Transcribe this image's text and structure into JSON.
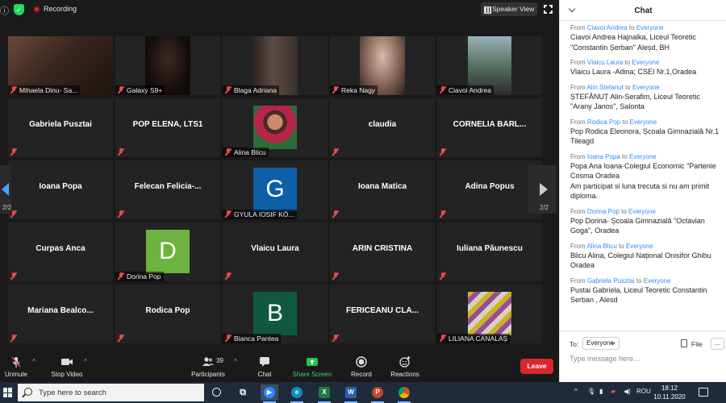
{
  "meeting": {
    "recording_label": "Recording",
    "view_button": "Speaker View",
    "page_indicator": "2/2",
    "tiles": [
      {
        "name": "",
        "label": "Mihaela Dinu- Sa...",
        "kind": "video"
      },
      {
        "name": "",
        "label": "Galaxy S9+",
        "kind": "video"
      },
      {
        "name": "",
        "label": "Blaga Adriana",
        "kind": "video"
      },
      {
        "name": "",
        "label": "Reka Nagy",
        "kind": "video"
      },
      {
        "name": "",
        "label": "Ciavoi Andrea",
        "kind": "video"
      },
      {
        "name": "Gabriela Pusztai",
        "label": "",
        "kind": "name"
      },
      {
        "name": "POP ELENA, LTS1",
        "label": "",
        "kind": "name"
      },
      {
        "name": "",
        "label": "Alina Blicu",
        "kind": "photo"
      },
      {
        "name": "claudia",
        "label": "",
        "kind": "name"
      },
      {
        "name": "CORNELIA BÂRL...",
        "label": "",
        "kind": "name"
      },
      {
        "name": "Ioana Popa",
        "label": "",
        "kind": "name"
      },
      {
        "name": "Felecan  Felicia-...",
        "label": "",
        "kind": "name"
      },
      {
        "name": "",
        "label": "GYULA IOSIF KÖ...",
        "kind": "letter",
        "letter": "G",
        "color": "#0e5fa8"
      },
      {
        "name": "Ioana Matica",
        "label": "",
        "kind": "name"
      },
      {
        "name": "Adina Popus",
        "label": "",
        "kind": "name"
      },
      {
        "name": "Curpas Anca",
        "label": "",
        "kind": "name"
      },
      {
        "name": "",
        "label": "Dorina Pop",
        "kind": "letter",
        "letter": "D",
        "color": "#6eb33f"
      },
      {
        "name": "Vlaicu Laura",
        "label": "",
        "kind": "name"
      },
      {
        "name": "ARIN CRISTINA",
        "label": "",
        "kind": "name"
      },
      {
        "name": "Iuliana Păunescu",
        "label": "",
        "kind": "name"
      },
      {
        "name": "Mariana  Bealco...",
        "label": "",
        "kind": "name"
      },
      {
        "name": "Rodica Pop",
        "label": "",
        "kind": "name"
      },
      {
        "name": "",
        "label": "Bianca Pantea",
        "kind": "letter",
        "letter": "B",
        "color": "#0f5a3e"
      },
      {
        "name": "FERICEANU  CLA...",
        "label": "",
        "kind": "name"
      },
      {
        "name": "",
        "label": "LILIANA CANALAȘ",
        "kind": "pattern"
      }
    ]
  },
  "toolbar": {
    "unmute": "Unmute",
    "stop_video": "Stop Video",
    "participants": "Participants",
    "participants_count": "39",
    "chat": "Chat",
    "share_screen": "Share Screen",
    "record": "Record",
    "reactions": "Reactions",
    "leave": "Leave"
  },
  "chat": {
    "title": "Chat",
    "from_word": "From",
    "to_word": "to",
    "messages": [
      {
        "from": "Ciavoi Andrea",
        "to": "Everyone",
        "text": "Ciavoi Andrea Hajnalka, Liceul Teoretic \"Constantin Șerban\" Aleșd, BH"
      },
      {
        "from": "Vlaicu Laura",
        "to": "Everyone",
        "text": "Vlaicu Laura -Adina; CSEI Nr.1,Oradea"
      },
      {
        "from": "Alin Stefanut",
        "to": "Everyone",
        "text": "ȘTEFĂNUȚ Alin-Serafim, Liceul Teoretic \"Arany Janos\", Salonta"
      },
      {
        "from": "Rodica Pop",
        "to": "Everyone",
        "text": "Pop Rodica Eleonora, Școala Gimnazială Nr.1 Tileagd"
      },
      {
        "from": "Ioana Popa",
        "to": "Everyone",
        "text": "Popa Ana Ioana-Colegiul Economic \"Partenie Cosma Oradea\nAm participat si luna trecuta si nu am primit diploma."
      },
      {
        "from": "Dorina Pop",
        "to": "Everyone",
        "text": "Pop Dorina- Școala Gimnazială \"Octavian Goga\",  Oradea"
      },
      {
        "from": "Alina Blicu",
        "to": "Everyone",
        "text": "Blicu Alina, Colegiul Național Onisifor Ghibu Oradea"
      },
      {
        "from": "Gabriela Pusztai",
        "to": "Everyone",
        "text": "Pustai Gabriela, Liceul Teoretic Constantin Serban , Alesd"
      }
    ],
    "to_label": "To:",
    "recipient": "Everyone",
    "file_label": "File",
    "more": "...",
    "input_placeholder": "Type message here..."
  },
  "taskbar": {
    "search_placeholder": "Type here to search",
    "language": "ROU",
    "time": "18:12",
    "date": "10.11.2020"
  }
}
